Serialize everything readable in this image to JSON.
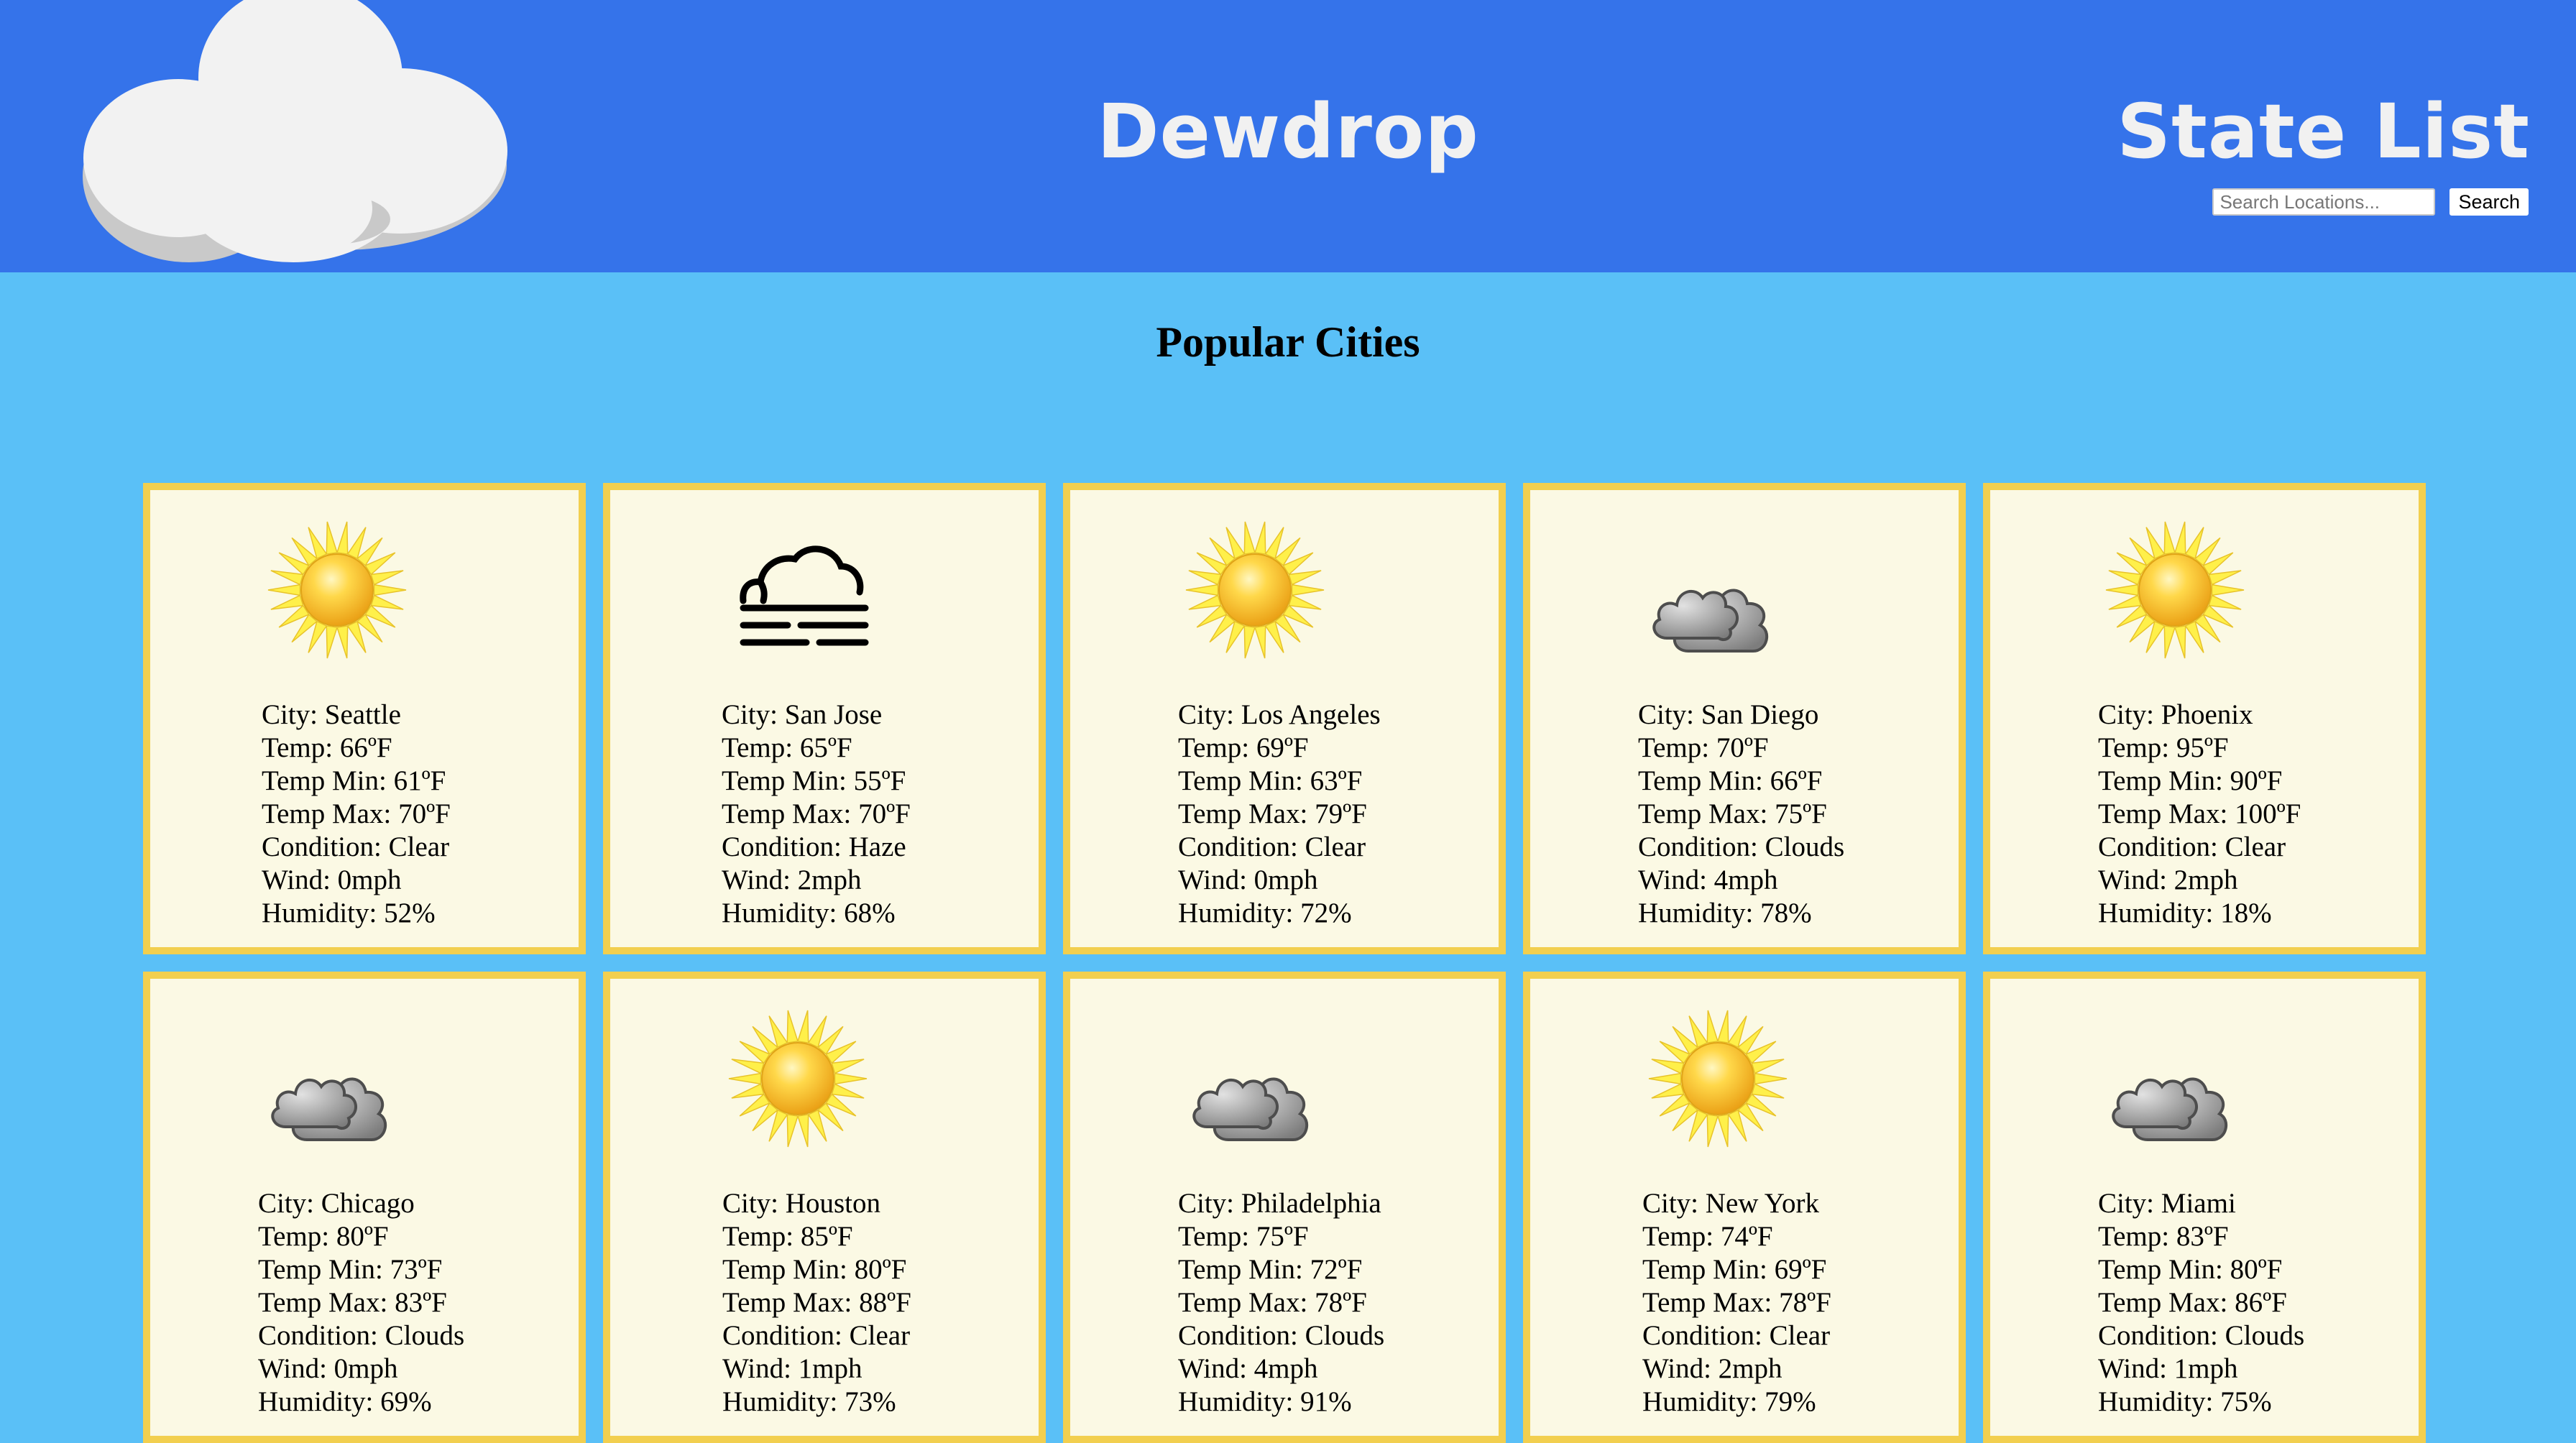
{
  "app": {
    "brand": "Dewdrop",
    "nav_state_list": "State List"
  },
  "search": {
    "placeholder": "Search Locations...",
    "button_label": "Search"
  },
  "main": {
    "section_title": "Popular Cities"
  },
  "labels": {
    "city": "City: ",
    "temp": "Temp: ",
    "temp_min": "Temp Min: ",
    "temp_max": "Temp Max: ",
    "condition": "Condition: ",
    "wind": "Wind: ",
    "humidity": "Humidity: "
  },
  "cities": [
    {
      "city": "Seattle",
      "temp": "66ºF",
      "temp_min": "61ºF",
      "temp_max": "70ºF",
      "condition": "Clear",
      "wind": "0mph",
      "humidity": "52%",
      "icon": "sun-icon"
    },
    {
      "city": "San Jose",
      "temp": "65ºF",
      "temp_min": "55ºF",
      "temp_max": "70ºF",
      "condition": "Haze",
      "wind": "2mph",
      "humidity": "68%",
      "icon": "haze-icon"
    },
    {
      "city": "Los Angeles",
      "temp": "69ºF",
      "temp_min": "63ºF",
      "temp_max": "79ºF",
      "condition": "Clear",
      "wind": "0mph",
      "humidity": "72%",
      "icon": "sun-icon"
    },
    {
      "city": "San Diego",
      "temp": "70ºF",
      "temp_min": "66ºF",
      "temp_max": "75ºF",
      "condition": "Clouds",
      "wind": "4mph",
      "humidity": "78%",
      "icon": "clouds-icon"
    },
    {
      "city": "Phoenix",
      "temp": "95ºF",
      "temp_min": "90ºF",
      "temp_max": "100ºF",
      "condition": "Clear",
      "wind": "2mph",
      "humidity": "18%",
      "icon": "sun-icon"
    },
    {
      "city": "Chicago",
      "temp": "80ºF",
      "temp_min": "73ºF",
      "temp_max": "83ºF",
      "condition": "Clouds",
      "wind": "0mph",
      "humidity": "69%",
      "icon": "clouds-icon"
    },
    {
      "city": "Houston",
      "temp": "85ºF",
      "temp_min": "80ºF",
      "temp_max": "88ºF",
      "condition": "Clear",
      "wind": "1mph",
      "humidity": "73%",
      "icon": "sun-icon"
    },
    {
      "city": "Philadelphia",
      "temp": "75ºF",
      "temp_min": "72ºF",
      "temp_max": "78ºF",
      "condition": "Clouds",
      "wind": "4mph",
      "humidity": "91%",
      "icon": "clouds-icon"
    },
    {
      "city": "New York",
      "temp": "74ºF",
      "temp_min": "69ºF",
      "temp_max": "78ºF",
      "condition": "Clear",
      "wind": "2mph",
      "humidity": "79%",
      "icon": "sun-icon"
    },
    {
      "city": "Miami",
      "temp": "83ºF",
      "temp_min": "80ºF",
      "temp_max": "86ºF",
      "condition": "Clouds",
      "wind": "1mph",
      "humidity": "75%",
      "icon": "clouds-icon"
    }
  ],
  "colors": {
    "header_bg": "#3573ea",
    "page_bg": "#5ac0f7",
    "card_border": "#f2cf4f",
    "card_bg": "#fbf9e4",
    "brand_text": "#f1f1f1"
  }
}
